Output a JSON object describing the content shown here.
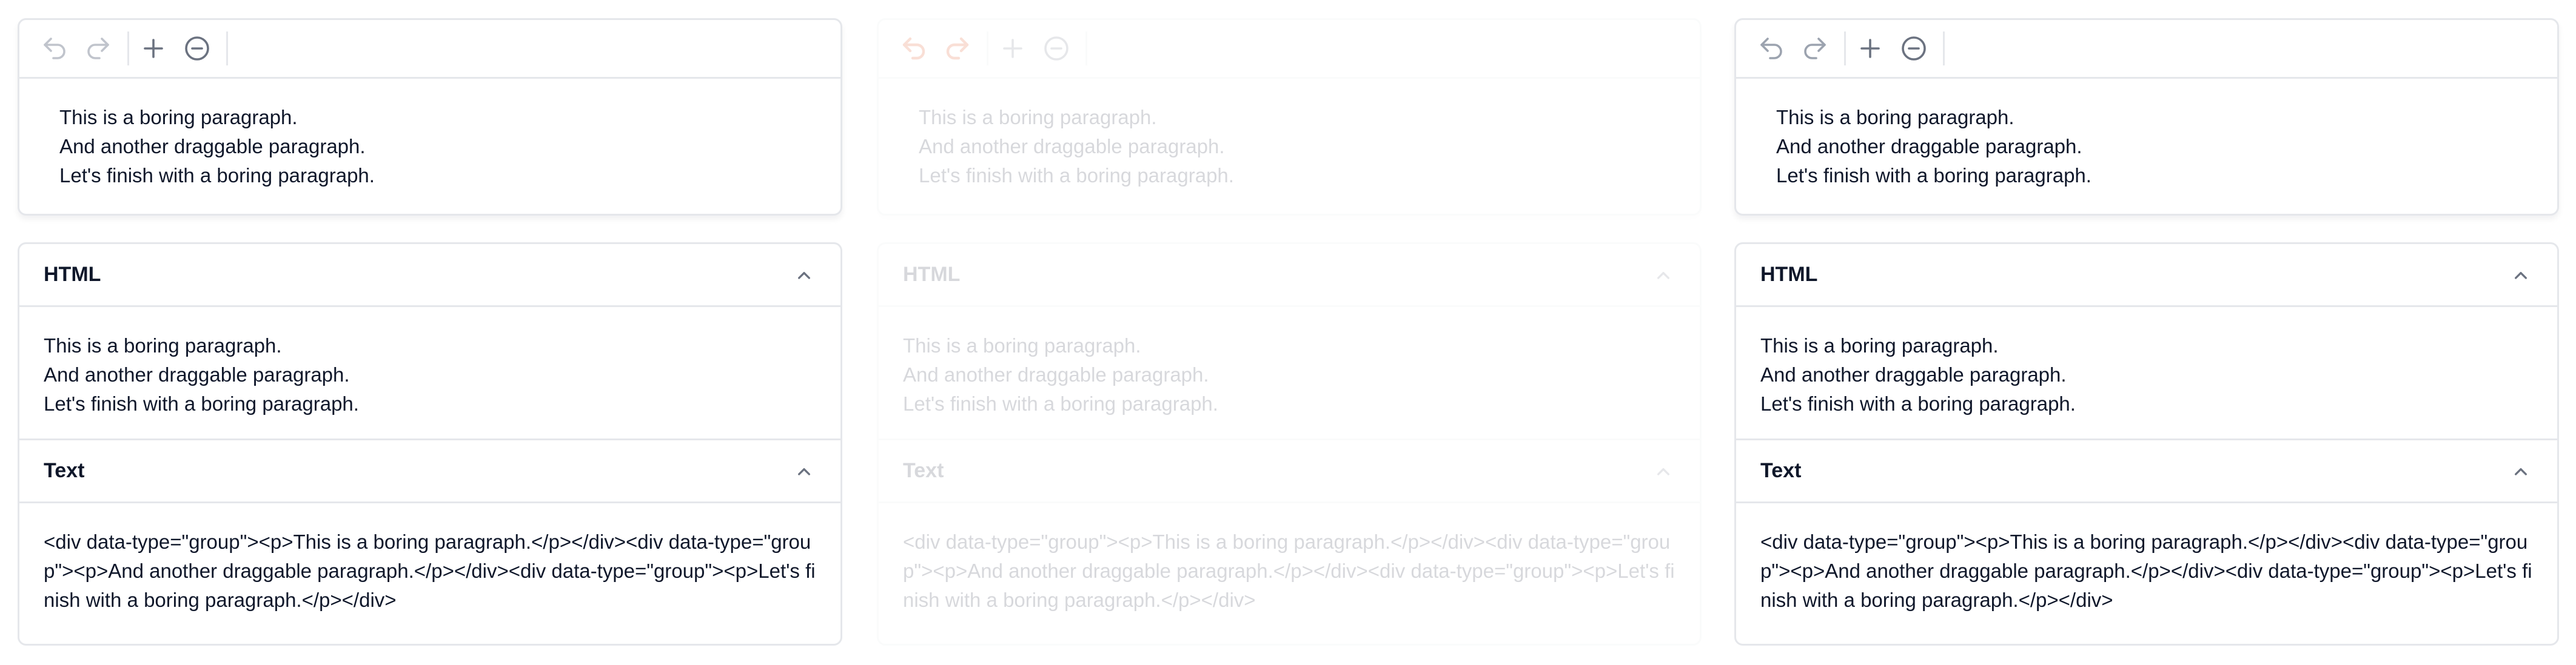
{
  "colors": {
    "accent_undo_redo": "#e03e0b",
    "icon_muted": "#9ca3af",
    "border": "#e5e7eb",
    "text": "#0f172a"
  },
  "toolbar": {
    "undo_icon": "undo-icon",
    "redo_icon": "redo-icon",
    "add_icon": "plus-icon",
    "remove_icon": "minus-circle-icon"
  },
  "panels": [
    {
      "editor": {
        "paragraphs": [
          "This is a boring paragraph.",
          "And another draggable paragraph.",
          "Let's finish with a boring paragraph."
        ]
      },
      "html_section": {
        "title": "HTML",
        "lines": [
          "This is a boring paragraph.",
          "And another draggable paragraph.",
          "Let's finish with a boring paragraph."
        ]
      },
      "text_section": {
        "title": "Text",
        "content": "<div data-type=\"group\"><p>This is a boring paragraph.</p></div><div data-type=\"group\"><p>And another draggable paragraph.</p></div><div data-type=\"group\"><p>Let's finish with a boring paragraph.</p></div>"
      }
    },
    {
      "editor": {
        "paragraphs": [
          "This is a boring paragraph.",
          "And another draggable paragraph.",
          "Let's finish with a boring paragraph."
        ]
      },
      "html_section": {
        "title": "HTML",
        "lines": [
          "This is a boring paragraph.",
          "And another draggable paragraph.",
          "Let's finish with a boring paragraph."
        ]
      },
      "text_section": {
        "title": "Text",
        "content": "<div data-type=\"group\"><p>This is a boring paragraph.</p></div><div data-type=\"group\"><p>And another draggable paragraph.</p></div><div data-type=\"group\"><p>Let's finish with a boring paragraph.</p></div>"
      }
    },
    {
      "editor": {
        "paragraphs": [
          "This is a boring paragraph.",
          "And another draggable paragraph.",
          "Let's finish with a boring paragraph."
        ]
      },
      "html_section": {
        "title": "HTML",
        "lines": [
          "This is a boring paragraph.",
          "And another draggable paragraph.",
          "Let's finish with a boring paragraph."
        ]
      },
      "text_section": {
        "title": "Text",
        "content": "<div data-type=\"group\"><p>This is a boring paragraph.</p></div><div data-type=\"group\"><p>And another draggable paragraph.</p></div><div data-type=\"group\"><p>Let's finish with a boring paragraph.</p></div>"
      }
    }
  ]
}
